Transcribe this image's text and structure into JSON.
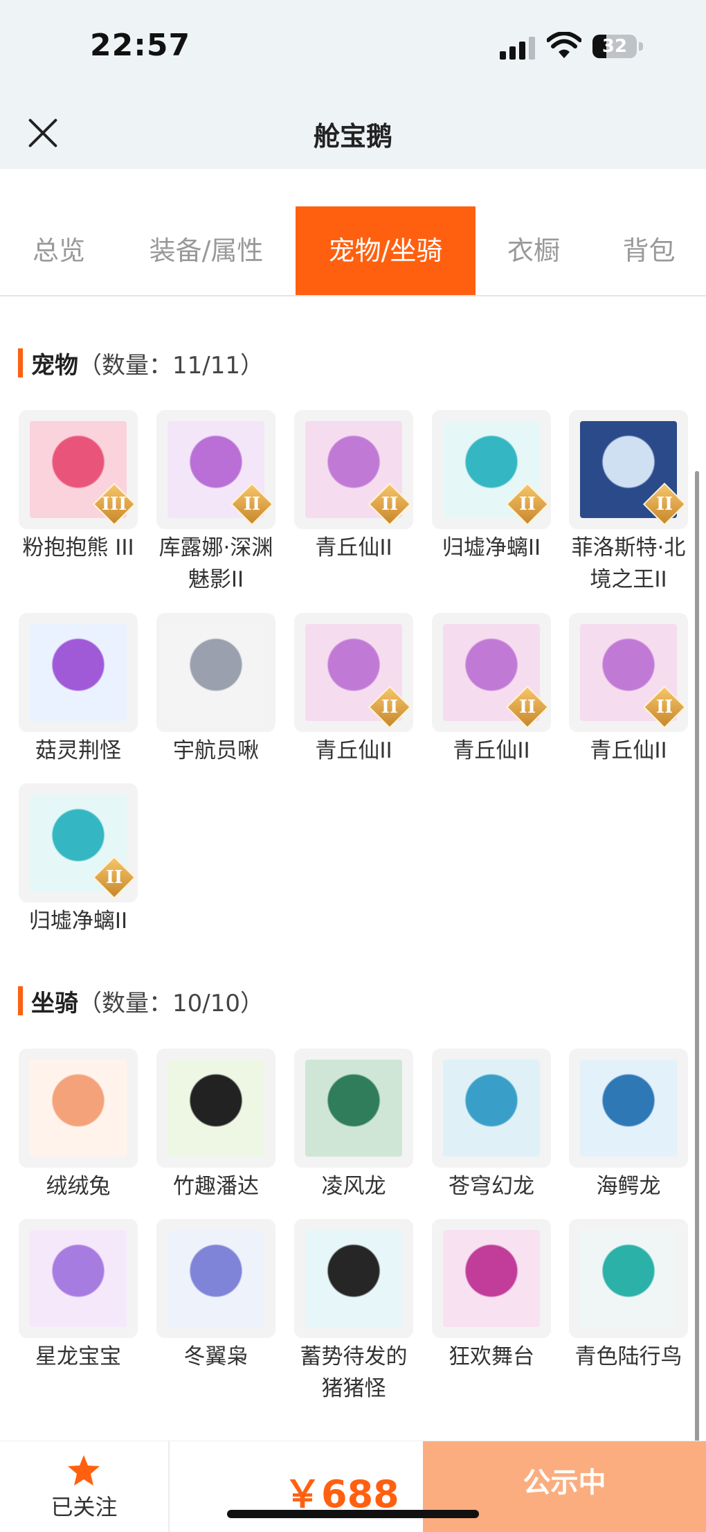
{
  "status_bar": {
    "time": "22:57",
    "battery": "32",
    "battery_level": 0.32
  },
  "header": {
    "title": "舱宝鹅",
    "close_icon": "close-icon"
  },
  "tabs": [
    {
      "label": "总览",
      "active": false
    },
    {
      "label": "装备/属性",
      "active": false
    },
    {
      "label": "宠物/坐骑",
      "active": true
    },
    {
      "label": "衣橱",
      "active": false
    },
    {
      "label": "背包",
      "active": false
    }
  ],
  "pets": {
    "title": "宠物",
    "count": "（数量：11/11）",
    "items": [
      {
        "name": "粉抱抱熊 III",
        "badge": "III",
        "colors": [
          "#fbd3dc",
          "#e9557a"
        ]
      },
      {
        "name": "库露娜·深渊魅影II",
        "badge": "II",
        "colors": [
          "#f2e6f8",
          "#b96fd6"
        ]
      },
      {
        "name": "青丘仙II",
        "badge": "II",
        "colors": [
          "#f6dcef",
          "#c07ad6"
        ]
      },
      {
        "name": "归墟净螭II",
        "badge": "II",
        "colors": [
          "#e6f7f7",
          "#34b7c2"
        ]
      },
      {
        "name": "菲洛斯特·北境之王II",
        "badge": "II",
        "colors": [
          "#2b4a8a",
          "#cfe0f3"
        ]
      },
      {
        "name": "菇灵荆怪",
        "badge": "",
        "colors": [
          "#eaf2ff",
          "#a05ad8"
        ]
      },
      {
        "name": "宇航员啾",
        "badge": "",
        "colors": [
          "#f4f4f4",
          "#9aa0ad"
        ]
      },
      {
        "name": "青丘仙II",
        "badge": "II",
        "colors": [
          "#f6dcef",
          "#c07ad6"
        ]
      },
      {
        "name": "青丘仙II",
        "badge": "II",
        "colors": [
          "#f6dcef",
          "#c07ad6"
        ]
      },
      {
        "name": "青丘仙II",
        "badge": "II",
        "colors": [
          "#f6dcef",
          "#c07ad6"
        ]
      },
      {
        "name": "归墟净螭II",
        "badge": "II",
        "colors": [
          "#e6f7f7",
          "#34b7c2"
        ]
      }
    ]
  },
  "mounts": {
    "title": "坐骑",
    "count": "（数量：10/10）",
    "items": [
      {
        "name": "绒绒兔",
        "colors": [
          "#fff3ec",
          "#f3a27a"
        ]
      },
      {
        "name": "竹趣潘达",
        "colors": [
          "#eef7e4",
          "#222222"
        ]
      },
      {
        "name": "凌风龙",
        "colors": [
          "#cfe6d6",
          "#2f7d5a"
        ]
      },
      {
        "name": "苍穹幻龙",
        "colors": [
          "#dff1f7",
          "#3a9fc8"
        ]
      },
      {
        "name": "海鳄龙",
        "colors": [
          "#e3f1fb",
          "#2f78b6"
        ]
      },
      {
        "name": "星龙宝宝",
        "colors": [
          "#f5e8fb",
          "#a77ce0"
        ]
      },
      {
        "name": "冬翼枭",
        "colors": [
          "#eef2fb",
          "#7f84d8"
        ]
      },
      {
        "name": "蓄势待发的猪猪怪",
        "colors": [
          "#e7f6f8",
          "#262626"
        ]
      },
      {
        "name": "狂欢舞台",
        "colors": [
          "#f8e1f1",
          "#c23c9a"
        ]
      },
      {
        "name": "青色陆行鸟",
        "colors": [
          "#f0f6f6",
          "#2bb1a8"
        ]
      }
    ]
  },
  "bottom_bar": {
    "follow_label": "已关注",
    "follow_icon": "star-icon",
    "price": "￥688",
    "cta_label": "公示中"
  },
  "colors": {
    "accent": "#ff6010",
    "cta": "#fbad7f"
  }
}
